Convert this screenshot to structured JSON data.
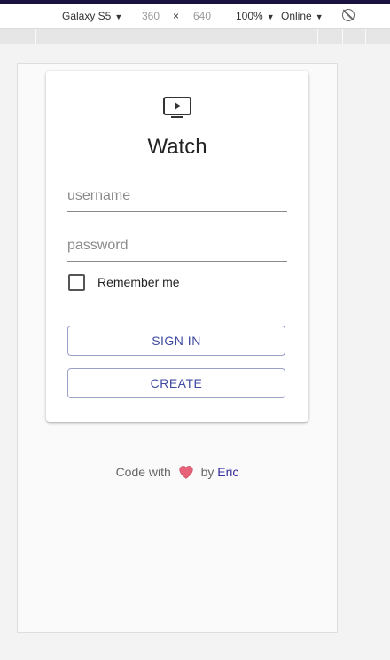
{
  "devtools": {
    "device_name": "Galaxy S5",
    "width_value": "360",
    "times_symbol": "×",
    "height_value": "640",
    "zoom": "100%",
    "network": "Online",
    "caret": "▼"
  },
  "app": {
    "icon": "tv-icon",
    "title": "Watch",
    "username_placeholder": "username",
    "password_placeholder": "password",
    "remember_label": "Remember me",
    "remember_checked": false,
    "sign_in_label": "SIGN IN",
    "create_label": "CREATE",
    "accent_color": "#3f4aa0"
  },
  "footer": {
    "prefix": "Code with",
    "heart_icon": "heart-icon",
    "by": "by",
    "author": "Eric",
    "heart_color": "#e8637a"
  }
}
